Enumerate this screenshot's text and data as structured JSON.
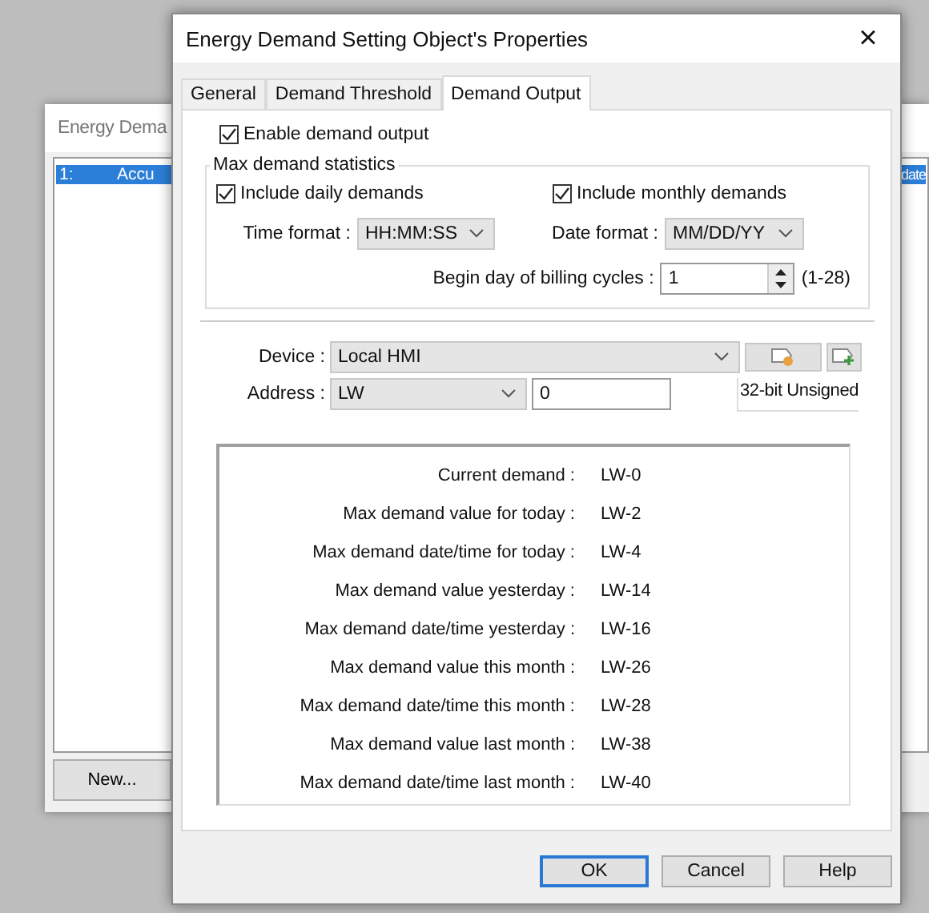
{
  "background_window": {
    "title": "Energy Dema",
    "rows": [
      {
        "number": "1:",
        "name": "Accu",
        "tail": "date",
        "selected": true
      }
    ],
    "buttons": [
      "New..."
    ]
  },
  "dialog": {
    "title": "Energy Demand Setting Object's Properties",
    "close": "×",
    "tabs": [
      {
        "label": "General",
        "selected": false
      },
      {
        "label": "Demand Threshold",
        "selected": false
      },
      {
        "label": "Demand Output",
        "selected": true
      }
    ],
    "enable_output": {
      "label": "Enable demand output",
      "checked": true
    },
    "max_demand_statistics": {
      "title": "Max demand statistics",
      "include_daily": {
        "label": "Include daily demands",
        "checked": true
      },
      "include_monthly": {
        "label": "Include monthly demands",
        "checked": true
      },
      "time_format": {
        "label": "Time format :",
        "value": "HH:MM:SS"
      },
      "date_format": {
        "label": "Date format :",
        "value": "MM/DD/YY"
      },
      "billing_begin": {
        "label": "Begin day of billing cycles :",
        "value": "1",
        "range": "(1-28)"
      }
    },
    "device": {
      "label": "Device :",
      "value": "Local HMI"
    },
    "address": {
      "label": "Address :",
      "type": "LW",
      "value": "0",
      "data_type": "32-bit Unsigned"
    },
    "outputs": [
      {
        "label": "Current demand :",
        "address": "LW-0"
      },
      {
        "label": "Max demand value for today :",
        "address": "LW-2"
      },
      {
        "label": "Max demand date/time for today :",
        "address": "LW-4"
      },
      {
        "label": "Max demand value yesterday :",
        "address": "LW-14"
      },
      {
        "label": "Max demand date/time yesterday :",
        "address": "LW-16"
      },
      {
        "label": "Max demand value this month :",
        "address": "LW-26"
      },
      {
        "label": "Max demand date/time this month :",
        "address": "LW-28"
      },
      {
        "label": "Max demand value last month :",
        "address": "LW-38"
      },
      {
        "label": "Max demand date/time last month :",
        "address": "LW-40"
      }
    ],
    "buttons": [
      {
        "label": "OK",
        "default": true
      },
      {
        "label": "Cancel",
        "default": false
      },
      {
        "label": "Help",
        "default": false
      }
    ]
  }
}
